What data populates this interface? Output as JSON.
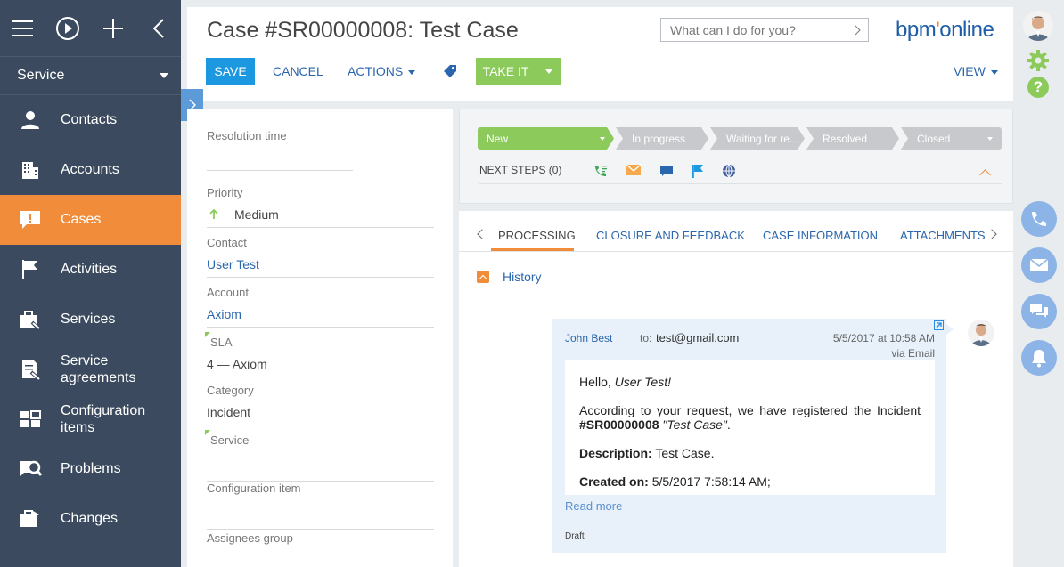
{
  "sidebar": {
    "section": "Service",
    "items": [
      {
        "label": "Contacts",
        "icon": "contacts-icon"
      },
      {
        "label": "Accounts",
        "icon": "accounts-icon"
      },
      {
        "label": "Cases",
        "icon": "cases-icon",
        "active": true
      },
      {
        "label": "Activities",
        "icon": "activities-icon"
      },
      {
        "label": "Services",
        "icon": "services-icon"
      },
      {
        "label": "Service agreements",
        "icon": "service-agreements-icon"
      },
      {
        "label": "Configuration items",
        "icon": "configuration-items-icon"
      },
      {
        "label": "Problems",
        "icon": "problems-icon"
      },
      {
        "label": "Changes",
        "icon": "changes-icon"
      }
    ]
  },
  "header": {
    "title": "Case #SR00000008: Test Case",
    "ask_placeholder": "What can I do for you?",
    "logo": "bpm'online",
    "save": "SAVE",
    "cancel": "CANCEL",
    "actions": "ACTIONS",
    "take_it": "TAKE IT",
    "view": "VIEW"
  },
  "fields": [
    {
      "label": "Resolution time",
      "value": ""
    },
    {
      "label": "Priority",
      "value": "Medium"
    },
    {
      "label": "Contact",
      "value": "User Test"
    },
    {
      "label": "Account",
      "value": "Axiom"
    },
    {
      "label": "SLA",
      "value": "4 — Axiom"
    },
    {
      "label": "Category",
      "value": "Incident"
    },
    {
      "label": "Service",
      "value": ""
    },
    {
      "label": "Configuration item",
      "value": ""
    },
    {
      "label": "Assignees group",
      "value": ""
    }
  ],
  "stages": [
    "New",
    "In progress",
    "Waiting for re...",
    "Resolved",
    "Closed"
  ],
  "next_steps": "NEXT STEPS (0)",
  "tabs": [
    "PROCESSING",
    "CLOSURE AND FEEDBACK",
    "CASE INFORMATION",
    "ATTACHMENTS"
  ],
  "history_label": "History",
  "email": {
    "from": "John Best",
    "to_label": "to:",
    "to": "test@gmail.com",
    "date": "5/5/2017 at 10:58 AM",
    "via": "via Email",
    "greeting_prefix": "Hello,",
    "greeting_name": "User Test!",
    "para1_prefix": "According to your request, we have registered the Incident",
    "para1_case": "#SR00000008",
    "para1_title": "\"Test Case\"",
    "para1_end": ".",
    "desc_label": "Description:",
    "desc_value": "Test Case.",
    "created_label": "Created on:",
    "created_value": "5/5/2017 7:58:14 AM;",
    "read_more": "Read more",
    "status": "Draft"
  },
  "colors": {
    "sidebar_bg": "#3b4a5e",
    "accent_orange": "#f08c3a",
    "primary_blue": "#1c98e0",
    "green": "#8ccb5b",
    "link_blue": "#2a66ad"
  }
}
